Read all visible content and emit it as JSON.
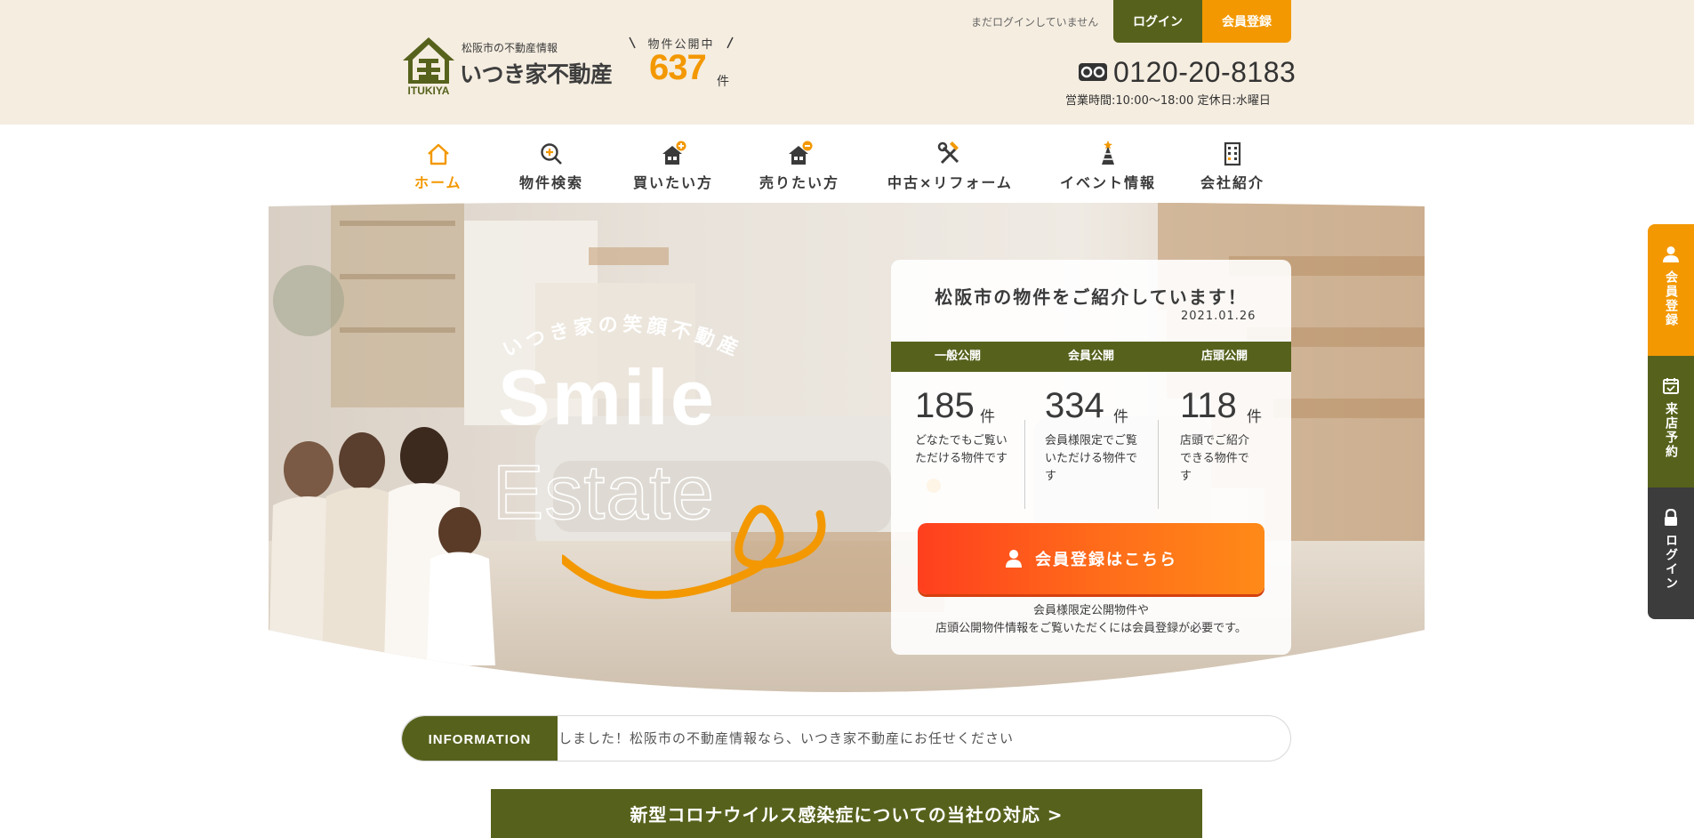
{
  "header": {
    "logo_subtitle": "松阪市の不動産情報",
    "logo_name": "いつき家不動産",
    "logo_en": "ITUKIYA",
    "published_label": "物件公開中",
    "published_count": "637",
    "published_unit": "件",
    "login_status": "まだログインしていません",
    "login_label": "ログイン",
    "register_label": "会員登録",
    "tel": "0120-20-8183",
    "hours": "営業時間:10:00～18:00 定休日:水曜日"
  },
  "nav": {
    "items": [
      {
        "label": "ホーム",
        "icon": "home-icon"
      },
      {
        "label": "物件検索",
        "icon": "search-icon"
      },
      {
        "label": "買いたい方",
        "icon": "house-plus-icon"
      },
      {
        "label": "売りたい方",
        "icon": "house-minus-icon"
      },
      {
        "label": "中古×リフォーム",
        "icon": "tools-icon"
      },
      {
        "label": "イベント情報",
        "icon": "party-hat-icon"
      },
      {
        "label": "会社紹介",
        "icon": "building-icon"
      }
    ],
    "active": "ホーム"
  },
  "hero": {
    "tagline": "いつき家の笑顔不動産",
    "word1": "Smile",
    "word2": "Estate",
    "card": {
      "title": "松阪市の物件をご紹介しています！",
      "date": "2021.01.26",
      "columns": [
        {
          "header": "一般公開",
          "count": "185",
          "unit": "件",
          "desc": "どなたでもご覧いただける物件です"
        },
        {
          "header": "会員公開",
          "count": "334",
          "unit": "件",
          "desc": "会員様限定でご覧いただける物件です"
        },
        {
          "header": "店頭公開",
          "count": "118",
          "unit": "件",
          "desc": "店頭でご紹介できる物件です"
        }
      ],
      "cta_label": "会員登録はこちら",
      "note_line1": "会員様限定公開物件や",
      "note_line2": "店頭公開物件情報をご覧いただくには会員登録が必要です。"
    }
  },
  "information": {
    "label": "INFORMATION",
    "text": "しました！松阪市の不動産情報なら、いつき家不動産にお任せください"
  },
  "banner": {
    "corona": "新型コロナウイルス感染症についての当社の対応 >"
  },
  "side_tabs": [
    {
      "label": "会員登録",
      "icon": "person-icon",
      "color": "#f39800"
    },
    {
      "label": "来店予約",
      "icon": "calendar-icon",
      "color": "#56621c"
    },
    {
      "label": "ログイン",
      "icon": "lock-icon",
      "color": "#3c3c3c"
    }
  ],
  "colors": {
    "brand_green": "#56621c",
    "accent_orange": "#f39800",
    "header_bg": "#f5ede0",
    "cta_red": "#ff3f1e"
  }
}
